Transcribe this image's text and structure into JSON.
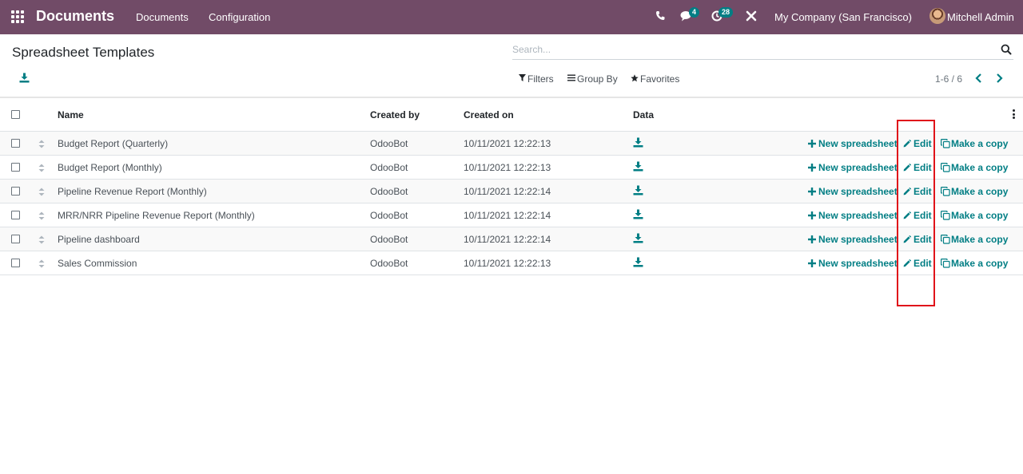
{
  "navbar": {
    "app_title": "Documents",
    "menus": [
      "Documents",
      "Configuration"
    ],
    "messages_badge": "4",
    "activities_badge": "28",
    "company": "My Company (San Francisco)",
    "user": "Mitchell Admin",
    "bg_color": "#714b67"
  },
  "control_panel": {
    "title": "Spreadsheet Templates",
    "search_placeholder": "Search...",
    "filters_label": "Filters",
    "group_by_label": "Group By",
    "favorites_label": "Favorites",
    "pager": "1-6 / 6"
  },
  "table": {
    "columns": [
      "Name",
      "Created by",
      "Created on",
      "Data"
    ],
    "rows": [
      {
        "name": "Budget Report (Quarterly)",
        "created_by": "OdooBot",
        "created_on": "10/11/2021 12:22:13"
      },
      {
        "name": "Budget Report (Monthly)",
        "created_by": "OdooBot",
        "created_on": "10/11/2021 12:22:13"
      },
      {
        "name": "Pipeline Revenue Report (Monthly)",
        "created_by": "OdooBot",
        "created_on": "10/11/2021 12:22:14"
      },
      {
        "name": "MRR/NRR Pipeline Revenue Report (Monthly)",
        "created_by": "OdooBot",
        "created_on": "10/11/2021 12:22:14"
      },
      {
        "name": "Pipeline dashboard",
        "created_by": "OdooBot",
        "created_on": "10/11/2021 12:22:14"
      },
      {
        "name": "Sales Commission",
        "created_by": "OdooBot",
        "created_on": "10/11/2021 12:22:13"
      }
    ],
    "actions": {
      "new_spreadsheet": "New spreadsheet",
      "edit": "Edit",
      "make_copy": "Make a copy"
    }
  },
  "colors": {
    "accent": "#017e84",
    "highlight": "#e0131a"
  }
}
